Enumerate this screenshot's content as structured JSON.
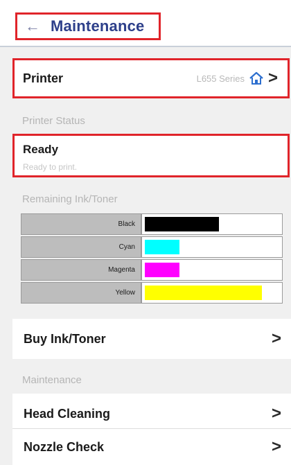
{
  "header": {
    "title": "Maintenance",
    "back_icon": "back-arrow-icon"
  },
  "printer": {
    "label": "Printer",
    "model": "L655 Series"
  },
  "printer_status": {
    "section_label": "Printer Status",
    "status": "Ready",
    "detail": "Ready to print."
  },
  "ink": {
    "section_label": "Remaining Ink/Toner",
    "items": [
      {
        "name": "Black",
        "color": "#000000",
        "level": 0.55
      },
      {
        "name": "Cyan",
        "color": "#00ffff",
        "level": 0.26
      },
      {
        "name": "Magenta",
        "color": "#ff00ff",
        "level": 0.26
      },
      {
        "name": "Yellow",
        "color": "#ffff00",
        "level": 0.87
      }
    ]
  },
  "buy": {
    "label": "Buy Ink/Toner"
  },
  "maintenance": {
    "section_label": "Maintenance",
    "items": [
      {
        "label": "Head Cleaning"
      },
      {
        "label": "Nozzle Check"
      }
    ]
  },
  "colors": {
    "accent": "#2d3f8a",
    "highlight": "#e0242a"
  }
}
